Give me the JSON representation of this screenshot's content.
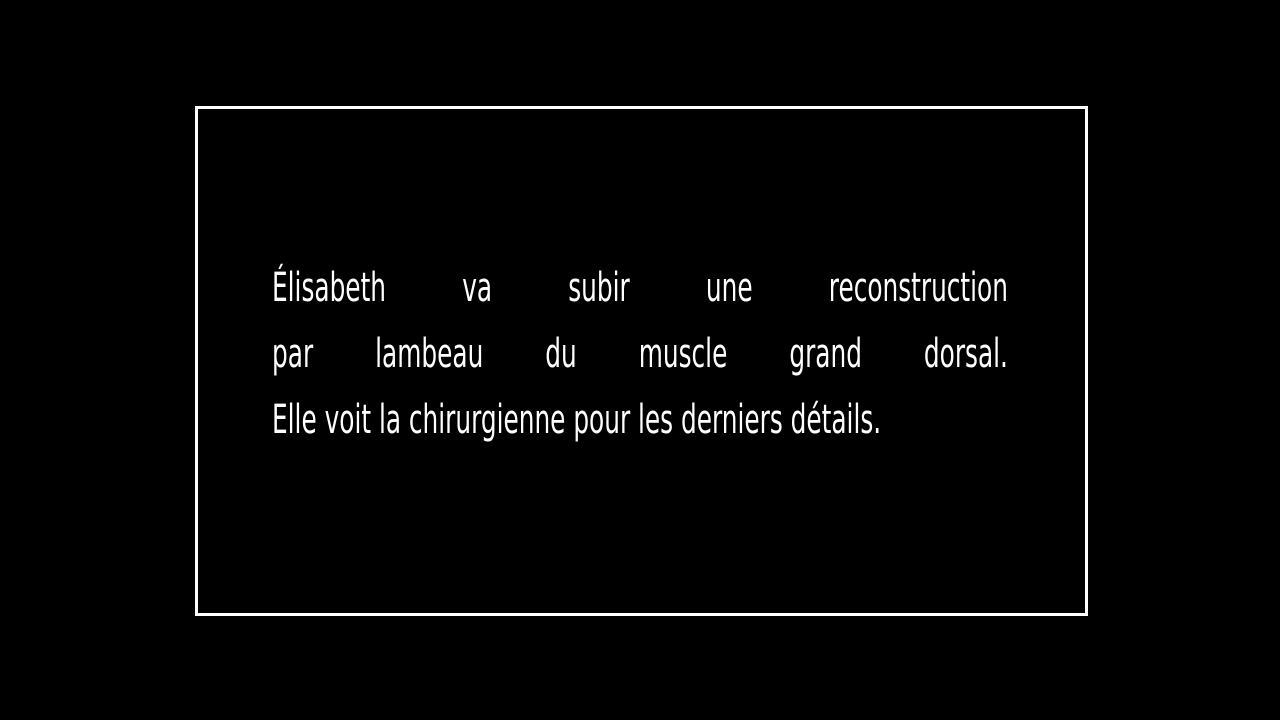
{
  "caption": {
    "lines": [
      "Élisabeth va subir une reconstruction",
      "par lambeau du muscle grand dorsal.",
      "Elle voit la chirurgienne pour les derniers détails."
    ]
  },
  "colors": {
    "background": "#000000",
    "text": "#ffffff",
    "frame": "#ffffff"
  }
}
